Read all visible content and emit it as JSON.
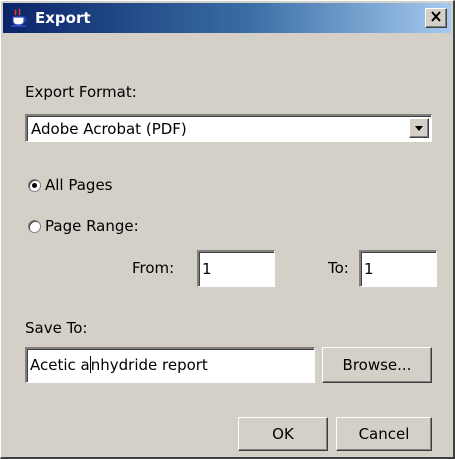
{
  "window": {
    "title": "Export",
    "close_label": "X"
  },
  "export_format": {
    "label": "Export Format:",
    "selected": "Adobe Acrobat (PDF)"
  },
  "page_selection": {
    "all_pages_label": "All Pages",
    "page_range_label": "Page Range:",
    "selected": "All Pages",
    "from_label": "From:",
    "from_value": "1",
    "to_label": "To:",
    "to_value": "1"
  },
  "save_to": {
    "label": "Save To:",
    "value_before_caret": "Acetic a",
    "value_after_caret": "nhydride report",
    "browse_label": "Browse..."
  },
  "footer": {
    "ok_label": "OK",
    "cancel_label": "Cancel"
  },
  "colors": {
    "title_start": "#0a246a",
    "title_end": "#a6caf0",
    "face": "#d4d0c8"
  },
  "icons": {
    "window": "java-coffee-cup-icon",
    "close": "close-icon",
    "dropdown": "triangle-down-icon"
  }
}
